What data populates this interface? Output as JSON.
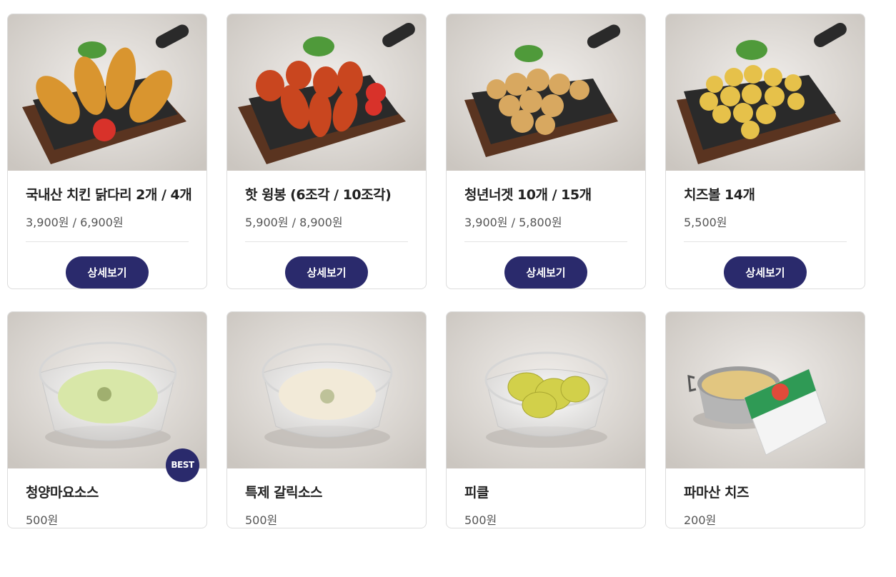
{
  "menu": {
    "row1": [
      {
        "title": "국내산 치킨 닭다리 2개 / 4개",
        "price": "3,900원 / 6,900원",
        "button": "상세보기",
        "image": "fried-drumsticks-on-skillet"
      },
      {
        "title": "핫 윙봉 (6조각 / 10조각)",
        "price": "5,900원 / 8,900원",
        "button": "상세보기",
        "image": "hot-wings-on-skillet"
      },
      {
        "title": "청년너겟 10개 / 15개",
        "price": "3,900원 / 5,800원",
        "button": "상세보기",
        "image": "nuggets-on-skillet"
      },
      {
        "title": "치즈볼 14개",
        "price": "5,500원",
        "button": "상세보기",
        "image": "cheese-balls-on-skillet"
      }
    ],
    "row2": [
      {
        "title": "청양마요소스",
        "price": "500원",
        "badge": "BEST",
        "image": "green-mayo-sauce-bowl"
      },
      {
        "title": "특제 갈릭소스",
        "price": "500원",
        "image": "garlic-sauce-bowl"
      },
      {
        "title": "피클",
        "price": "500원",
        "image": "pickle-bowl"
      },
      {
        "title": "파마산 치즈",
        "price": "200원",
        "image": "parmesan-cheese-pot-and-packet"
      }
    ]
  },
  "colors": {
    "button": "#2a2a6c",
    "badge": "#2a2a6c",
    "card_border": "#dcdcdc"
  }
}
